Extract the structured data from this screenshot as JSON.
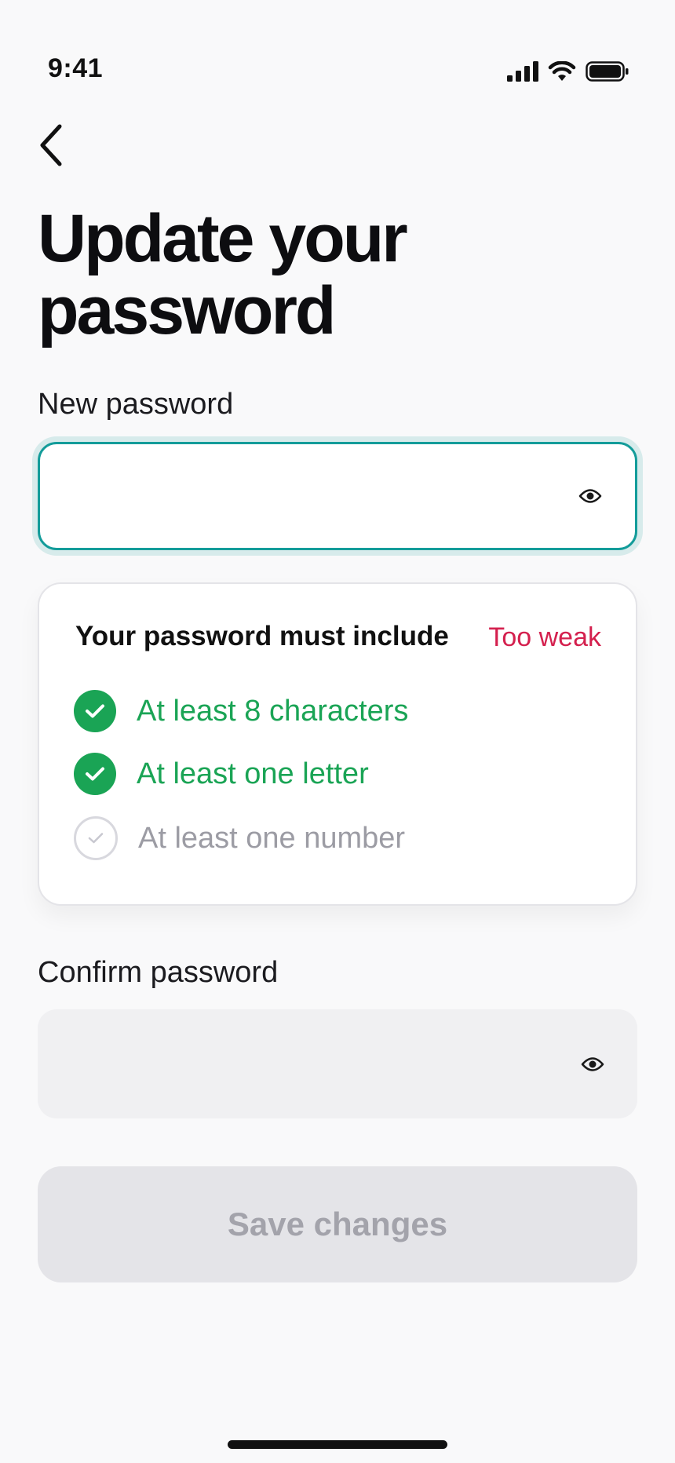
{
  "status_bar": {
    "time": "9:41"
  },
  "header": {
    "back_icon": "chevron-left-icon"
  },
  "page": {
    "title": "Update your password"
  },
  "new_password": {
    "label": "New password",
    "value": "",
    "placeholder": "",
    "toggle_icon": "eye-icon",
    "focus_color": "#139c9a"
  },
  "requirements": {
    "title": "Your password must include",
    "strength": "Too weak",
    "strength_color": "#d4204e",
    "items": [
      {
        "label": "At least 8 characters",
        "met": true
      },
      {
        "label": "At least one letter",
        "met": true
      },
      {
        "label": "At least one number",
        "met": false
      }
    ],
    "met_color": "#1aa455"
  },
  "confirm_password": {
    "label": "Confirm password",
    "value": "",
    "placeholder": "",
    "toggle_icon": "eye-icon"
  },
  "actions": {
    "save_label": "Save changes",
    "save_enabled": false
  }
}
